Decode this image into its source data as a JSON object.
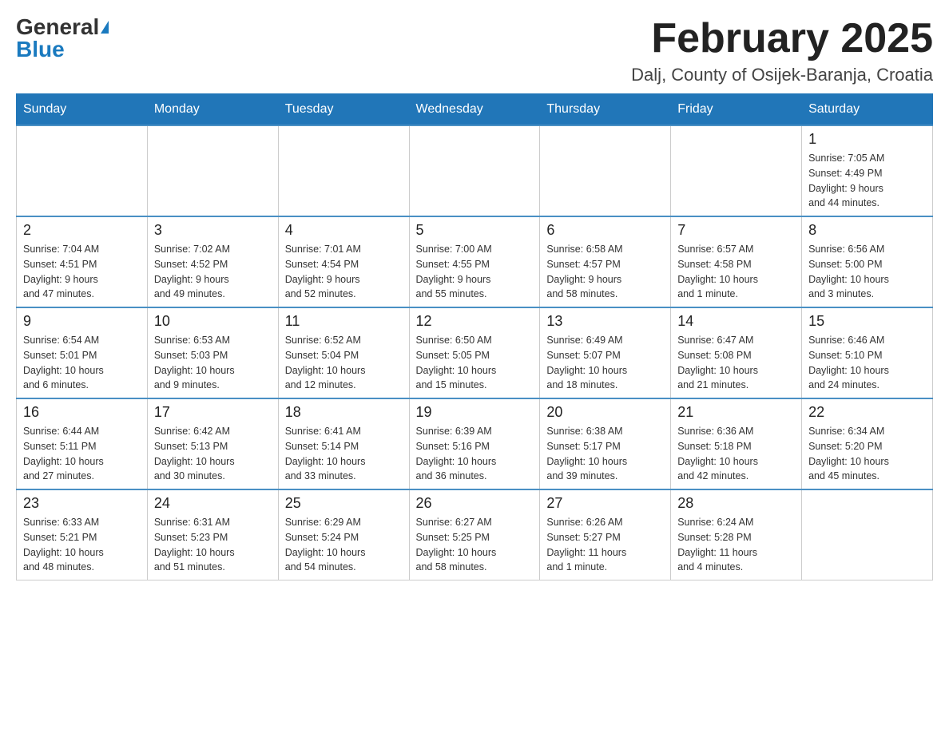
{
  "header": {
    "logo_general": "General",
    "logo_blue": "Blue",
    "month_title": "February 2025",
    "location": "Dalj, County of Osijek-Baranja, Croatia"
  },
  "days_of_week": [
    "Sunday",
    "Monday",
    "Tuesday",
    "Wednesday",
    "Thursday",
    "Friday",
    "Saturday"
  ],
  "weeks": [
    {
      "days": [
        {
          "number": "",
          "info": ""
        },
        {
          "number": "",
          "info": ""
        },
        {
          "number": "",
          "info": ""
        },
        {
          "number": "",
          "info": ""
        },
        {
          "number": "",
          "info": ""
        },
        {
          "number": "",
          "info": ""
        },
        {
          "number": "1",
          "info": "Sunrise: 7:05 AM\nSunset: 4:49 PM\nDaylight: 9 hours\nand 44 minutes."
        }
      ]
    },
    {
      "days": [
        {
          "number": "2",
          "info": "Sunrise: 7:04 AM\nSunset: 4:51 PM\nDaylight: 9 hours\nand 47 minutes."
        },
        {
          "number": "3",
          "info": "Sunrise: 7:02 AM\nSunset: 4:52 PM\nDaylight: 9 hours\nand 49 minutes."
        },
        {
          "number": "4",
          "info": "Sunrise: 7:01 AM\nSunset: 4:54 PM\nDaylight: 9 hours\nand 52 minutes."
        },
        {
          "number": "5",
          "info": "Sunrise: 7:00 AM\nSunset: 4:55 PM\nDaylight: 9 hours\nand 55 minutes."
        },
        {
          "number": "6",
          "info": "Sunrise: 6:58 AM\nSunset: 4:57 PM\nDaylight: 9 hours\nand 58 minutes."
        },
        {
          "number": "7",
          "info": "Sunrise: 6:57 AM\nSunset: 4:58 PM\nDaylight: 10 hours\nand 1 minute."
        },
        {
          "number": "8",
          "info": "Sunrise: 6:56 AM\nSunset: 5:00 PM\nDaylight: 10 hours\nand 3 minutes."
        }
      ]
    },
    {
      "days": [
        {
          "number": "9",
          "info": "Sunrise: 6:54 AM\nSunset: 5:01 PM\nDaylight: 10 hours\nand 6 minutes."
        },
        {
          "number": "10",
          "info": "Sunrise: 6:53 AM\nSunset: 5:03 PM\nDaylight: 10 hours\nand 9 minutes."
        },
        {
          "number": "11",
          "info": "Sunrise: 6:52 AM\nSunset: 5:04 PM\nDaylight: 10 hours\nand 12 minutes."
        },
        {
          "number": "12",
          "info": "Sunrise: 6:50 AM\nSunset: 5:05 PM\nDaylight: 10 hours\nand 15 minutes."
        },
        {
          "number": "13",
          "info": "Sunrise: 6:49 AM\nSunset: 5:07 PM\nDaylight: 10 hours\nand 18 minutes."
        },
        {
          "number": "14",
          "info": "Sunrise: 6:47 AM\nSunset: 5:08 PM\nDaylight: 10 hours\nand 21 minutes."
        },
        {
          "number": "15",
          "info": "Sunrise: 6:46 AM\nSunset: 5:10 PM\nDaylight: 10 hours\nand 24 minutes."
        }
      ]
    },
    {
      "days": [
        {
          "number": "16",
          "info": "Sunrise: 6:44 AM\nSunset: 5:11 PM\nDaylight: 10 hours\nand 27 minutes."
        },
        {
          "number": "17",
          "info": "Sunrise: 6:42 AM\nSunset: 5:13 PM\nDaylight: 10 hours\nand 30 minutes."
        },
        {
          "number": "18",
          "info": "Sunrise: 6:41 AM\nSunset: 5:14 PM\nDaylight: 10 hours\nand 33 minutes."
        },
        {
          "number": "19",
          "info": "Sunrise: 6:39 AM\nSunset: 5:16 PM\nDaylight: 10 hours\nand 36 minutes."
        },
        {
          "number": "20",
          "info": "Sunrise: 6:38 AM\nSunset: 5:17 PM\nDaylight: 10 hours\nand 39 minutes."
        },
        {
          "number": "21",
          "info": "Sunrise: 6:36 AM\nSunset: 5:18 PM\nDaylight: 10 hours\nand 42 minutes."
        },
        {
          "number": "22",
          "info": "Sunrise: 6:34 AM\nSunset: 5:20 PM\nDaylight: 10 hours\nand 45 minutes."
        }
      ]
    },
    {
      "days": [
        {
          "number": "23",
          "info": "Sunrise: 6:33 AM\nSunset: 5:21 PM\nDaylight: 10 hours\nand 48 minutes."
        },
        {
          "number": "24",
          "info": "Sunrise: 6:31 AM\nSunset: 5:23 PM\nDaylight: 10 hours\nand 51 minutes."
        },
        {
          "number": "25",
          "info": "Sunrise: 6:29 AM\nSunset: 5:24 PM\nDaylight: 10 hours\nand 54 minutes."
        },
        {
          "number": "26",
          "info": "Sunrise: 6:27 AM\nSunset: 5:25 PM\nDaylight: 10 hours\nand 58 minutes."
        },
        {
          "number": "27",
          "info": "Sunrise: 6:26 AM\nSunset: 5:27 PM\nDaylight: 11 hours\nand 1 minute."
        },
        {
          "number": "28",
          "info": "Sunrise: 6:24 AM\nSunset: 5:28 PM\nDaylight: 11 hours\nand 4 minutes."
        },
        {
          "number": "",
          "info": ""
        }
      ]
    }
  ]
}
